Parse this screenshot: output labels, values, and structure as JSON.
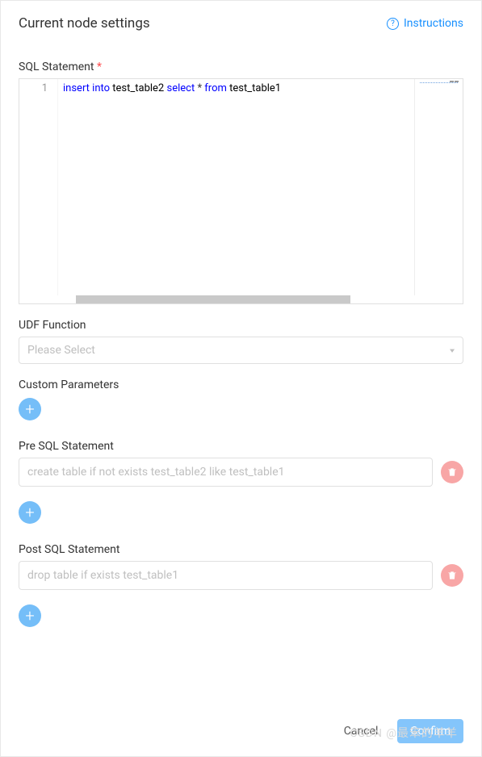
{
  "header": {
    "title": "Current node settings",
    "instructions_label": "Instructions"
  },
  "sql": {
    "label": "SQL Statement",
    "line_number": "1",
    "tokens": {
      "insert": "insert",
      "into": "into",
      "table2": "test_table2",
      "select": "select",
      "star": "*",
      "from": "from",
      "table1": "test_table1"
    }
  },
  "udf": {
    "label": "UDF Function",
    "placeholder": "Please Select"
  },
  "custom": {
    "label": "Custom Parameters"
  },
  "pre_sql": {
    "label": "Pre SQL Statement",
    "value": "create table if not exists test_table2 like test_table1"
  },
  "post_sql": {
    "label": "Post SQL Statement",
    "value": "drop table if exists test_table1"
  },
  "footer": {
    "cancel": "Cancel",
    "confirm": "Confirm"
  },
  "watermark": "CSDN @最笨的羊羊"
}
